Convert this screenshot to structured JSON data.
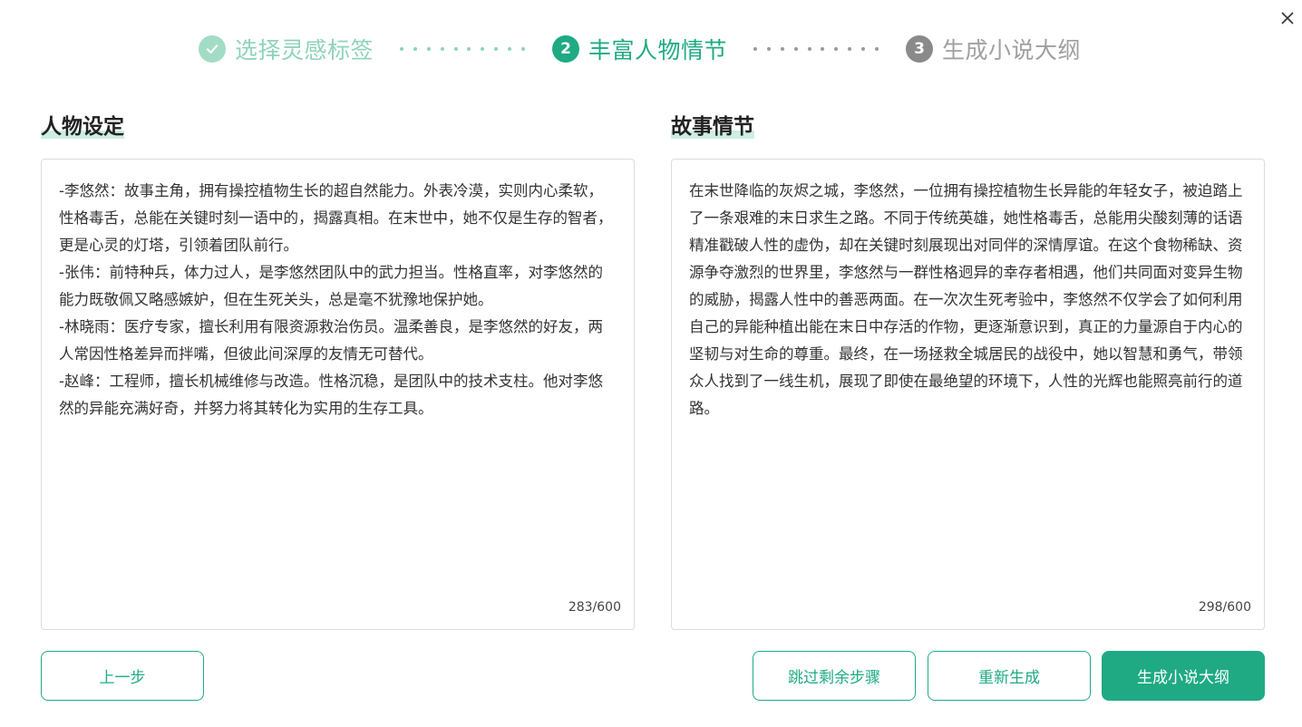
{
  "stepper": {
    "steps": [
      {
        "number": "",
        "label": "选择灵感标签",
        "state": "done"
      },
      {
        "number": "2",
        "label": "丰富人物情节",
        "state": "active"
      },
      {
        "number": "3",
        "label": "生成小说大纲",
        "state": "todo"
      }
    ]
  },
  "characters": {
    "title": "人物设定",
    "text": "-李悠然：故事主角，拥有操控植物生长的超自然能力。外表冷漠，实则内心柔软，性格毒舌，总能在关键时刻一语中的，揭露真相。在末世中，她不仅是生存的智者，更是心灵的灯塔，引领着团队前行。\n-张伟：前特种兵，体力过人，是李悠然团队中的武力担当。性格直率，对李悠然的能力既敬佩又略感嫉妒，但在生死关头，总是毫不犹豫地保护她。\n-林晓雨：医疗专家，擅长利用有限资源救治伤员。温柔善良，是李悠然的好友，两人常因性格差异而拌嘴，但彼此间深厚的友情无可替代。\n-赵峰：工程师，擅长机械维修与改造。性格沉稳，是团队中的技术支柱。他对李悠然的异能充满好奇，并努力将其转化为实用的生存工具。",
    "counter": "283/600"
  },
  "plot": {
    "title": "故事情节",
    "text": "在末世降临的灰烬之城，李悠然，一位拥有操控植物生长异能的年轻女子，被迫踏上了一条艰难的末日求生之路。不同于传统英雄，她性格毒舌，总能用尖酸刻薄的话语精准戳破人性的虚伪，却在关键时刻展现出对同伴的深情厚谊。在这个食物稀缺、资源争夺激烈的世界里，李悠然与一群性格迥异的幸存者相遇，他们共同面对变异生物的威胁，揭露人性中的善恶两面。在一次次生死考验中，李悠然不仅学会了如何利用自己的异能种植出能在末日中存活的作物，更逐渐意识到，真正的力量源自于内心的坚韧与对生命的尊重。最终，在一场拯救全城居民的战役中，她以智慧和勇气，带领众人找到了一线生机，展现了即使在最绝望的环境下，人性的光辉也能照亮前行的道路。",
    "counter": "298/600"
  },
  "buttons": {
    "prev": "上一步",
    "skip": "跳过剩余步骤",
    "regenerate": "重新生成",
    "generate": "生成小说大纲"
  },
  "colors": {
    "accent": "#1faa84",
    "done": "#a3dcc5",
    "todo": "#8a8a8a"
  },
  "icons": {
    "close": "close-icon",
    "step_done": "check-icon"
  }
}
